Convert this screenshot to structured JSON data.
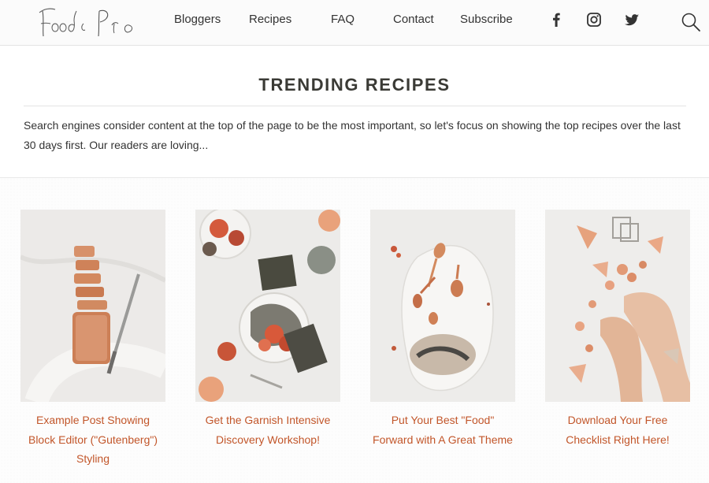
{
  "header": {
    "logo_text": "Food & Pro",
    "nav": [
      {
        "label": "Bloggers"
      },
      {
        "label": "Recipes"
      },
      {
        "label": "FAQ"
      },
      {
        "label": "Contact"
      },
      {
        "label": "Subscribe"
      }
    ],
    "social": [
      "facebook-icon",
      "instagram-icon",
      "twitter-icon"
    ],
    "search_icon": "search-icon"
  },
  "trending": {
    "title": "TRENDING RECIPES",
    "description": "Search engines consider content at the top of the page to be the most important, so let's focus on showing the top recipes over the last 30 days first. Our readers are loving..."
  },
  "recipes": [
    {
      "title": "Example Post Showing Block Editor (\"Gutenberg\") Styling"
    },
    {
      "title": "Get the Garnish Intensive Discovery Workshop!"
    },
    {
      "title": "Put Your Best \"Food\" Forward with A Great Theme"
    },
    {
      "title": "Download Your Free Checklist Right Here!"
    }
  ],
  "colors": {
    "accent": "#c2562a",
    "heading": "#3a3a35",
    "header_bg": "#fbfbfb"
  }
}
